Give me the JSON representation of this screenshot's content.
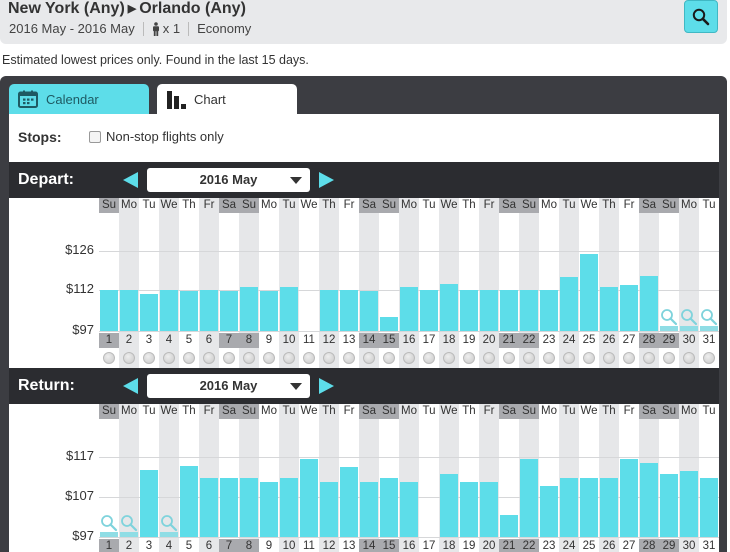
{
  "header": {
    "origin": "New York (Any)",
    "destination": "Orlando (Any)",
    "dates": "2016 May - 2016 May",
    "passengers": "x 1",
    "cabin": "Economy"
  },
  "note": "Estimated lowest prices only. Found in the last 15 days.",
  "tabs": [
    {
      "label": "Calendar",
      "icon": "calendar-icon",
      "active": false
    },
    {
      "label": "Chart",
      "icon": "bar-chart-icon",
      "active": true
    }
  ],
  "stops": {
    "label": "Stops:",
    "checkbox_label": "Non-stop flights only",
    "checked": false
  },
  "colors": {
    "accent": "#5ddde9",
    "weekend_header": "#a9aaae",
    "dark_bar": "#2b2c30"
  },
  "weekdays": [
    "Su",
    "Mo",
    "Tu",
    "We",
    "Th",
    "Fr",
    "Sa",
    "Su",
    "Mo",
    "Tu",
    "We",
    "Th",
    "Fr",
    "Sa",
    "Su",
    "Mo",
    "Tu",
    "We",
    "Th",
    "Fr",
    "Sa",
    "Su",
    "Mo",
    "Tu",
    "We",
    "Th",
    "Fr",
    "Sa",
    "Su",
    "Mo",
    "Tu"
  ],
  "depart": {
    "label": "Depart:",
    "month": "2016 May",
    "highlighted_days": [
      1,
      7,
      8,
      14,
      15,
      21,
      22,
      28,
      29
    ]
  },
  "return": {
    "label": "Return:",
    "month": "2016 May",
    "highlighted_days": [
      1,
      7,
      8,
      14,
      15,
      21,
      22,
      28,
      29
    ]
  },
  "chart_data": [
    {
      "type": "bar",
      "title": "Depart",
      "categories": [
        "1",
        "2",
        "3",
        "4",
        "5",
        "6",
        "7",
        "8",
        "9",
        "10",
        "11",
        "12",
        "13",
        "14",
        "15",
        "16",
        "17",
        "18",
        "19",
        "20",
        "21",
        "22",
        "23",
        "24",
        "25",
        "26",
        "27",
        "28",
        "29",
        "30",
        "31"
      ],
      "values": [
        112,
        112,
        110.5,
        112,
        111.5,
        112,
        111.5,
        113,
        111.5,
        113,
        96.5,
        112,
        112,
        111.5,
        102,
        113,
        112,
        114,
        112,
        112,
        112,
        112,
        112,
        116.5,
        125,
        113,
        113.5,
        117,
        null,
        null,
        null
      ],
      "yticks": [
        "$126",
        "$112",
        "$97"
      ],
      "ytick_values": [
        126,
        112,
        97
      ],
      "ylabel": "",
      "xlabel": "",
      "no_data_days": [
        29,
        30,
        31
      ]
    },
    {
      "type": "bar",
      "title": "Return",
      "categories": [
        "1",
        "2",
        "3",
        "4",
        "5",
        "6",
        "7",
        "8",
        "9",
        "10",
        "11",
        "12",
        "13",
        "14",
        "15",
        "16",
        "17",
        "18",
        "19",
        "20",
        "21",
        "22",
        "23",
        "24",
        "25",
        "26",
        "27",
        "28",
        "29",
        "30",
        "31"
      ],
      "values": [
        null,
        null,
        113.8,
        null,
        114.8,
        111.8,
        111.8,
        111.8,
        110.8,
        111.8,
        116.5,
        110.8,
        114.5,
        110.8,
        111.8,
        110.8,
        96.8,
        112.8,
        110.8,
        110.8,
        102.5,
        116.5,
        109.8,
        111.8,
        111.8,
        111.8,
        116.5,
        115.5,
        112.8,
        113.5,
        111.8
      ],
      "yticks": [
        "$117",
        "$107",
        "$97"
      ],
      "ytick_values": [
        117,
        107,
        97
      ],
      "ylabel": "",
      "xlabel": "",
      "no_data_days": [
        1,
        2,
        4
      ]
    }
  ]
}
